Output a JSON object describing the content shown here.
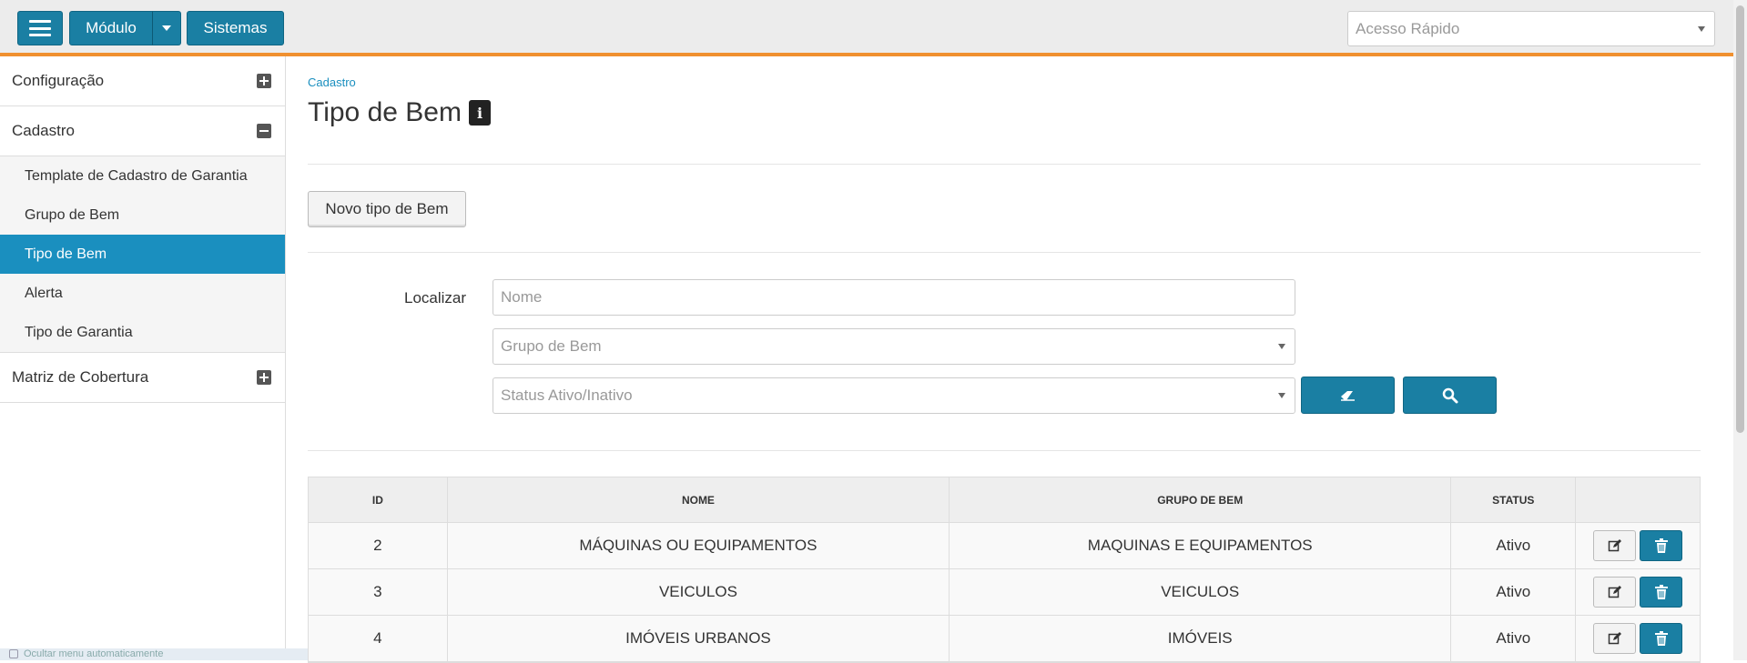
{
  "header": {
    "modulo_label": "Módulo",
    "sistemas_label": "Sistemas",
    "quick_access_placeholder": "Acesso Rápido"
  },
  "sidebar": {
    "groups": [
      {
        "label": "Configuração",
        "state": "collapsed"
      },
      {
        "label": "Cadastro",
        "state": "expanded",
        "items": [
          {
            "label": "Template de Cadastro de Garantia"
          },
          {
            "label": "Grupo de Bem"
          },
          {
            "label": "Tipo de Bem",
            "active": true
          },
          {
            "label": "Alerta"
          },
          {
            "label": "Tipo de Garantia"
          }
        ]
      },
      {
        "label": "Matriz de Cobertura",
        "state": "collapsed"
      }
    ],
    "footer_toast": "Ocultar menu automaticamente"
  },
  "page": {
    "breadcrumb": "Cadastro",
    "title": "Tipo de Bem",
    "new_button": "Novo tipo de Bem"
  },
  "filters": {
    "label": "Localizar",
    "nome_placeholder": "Nome",
    "grupo_placeholder": "Grupo de Bem",
    "status_placeholder": "Status Ativo/Inativo"
  },
  "table": {
    "columns": [
      "ID",
      "NOME",
      "GRUPO DE BEM",
      "STATUS"
    ],
    "rows": [
      {
        "id": "2",
        "nome": "MÁQUINAS OU EQUIPAMENTOS",
        "grupo": "MAQUINAS E EQUIPAMENTOS",
        "status": "Ativo"
      },
      {
        "id": "3",
        "nome": "VEICULOS",
        "grupo": "VEICULOS",
        "status": "Ativo"
      },
      {
        "id": "4",
        "nome": "IMÓVEIS URBANOS",
        "grupo": "IMÓVEIS",
        "status": "Ativo"
      }
    ]
  },
  "colors": {
    "primary": "#1a7fa3",
    "active_menu": "#1a8fbf",
    "header_accent": "#f0902f"
  }
}
